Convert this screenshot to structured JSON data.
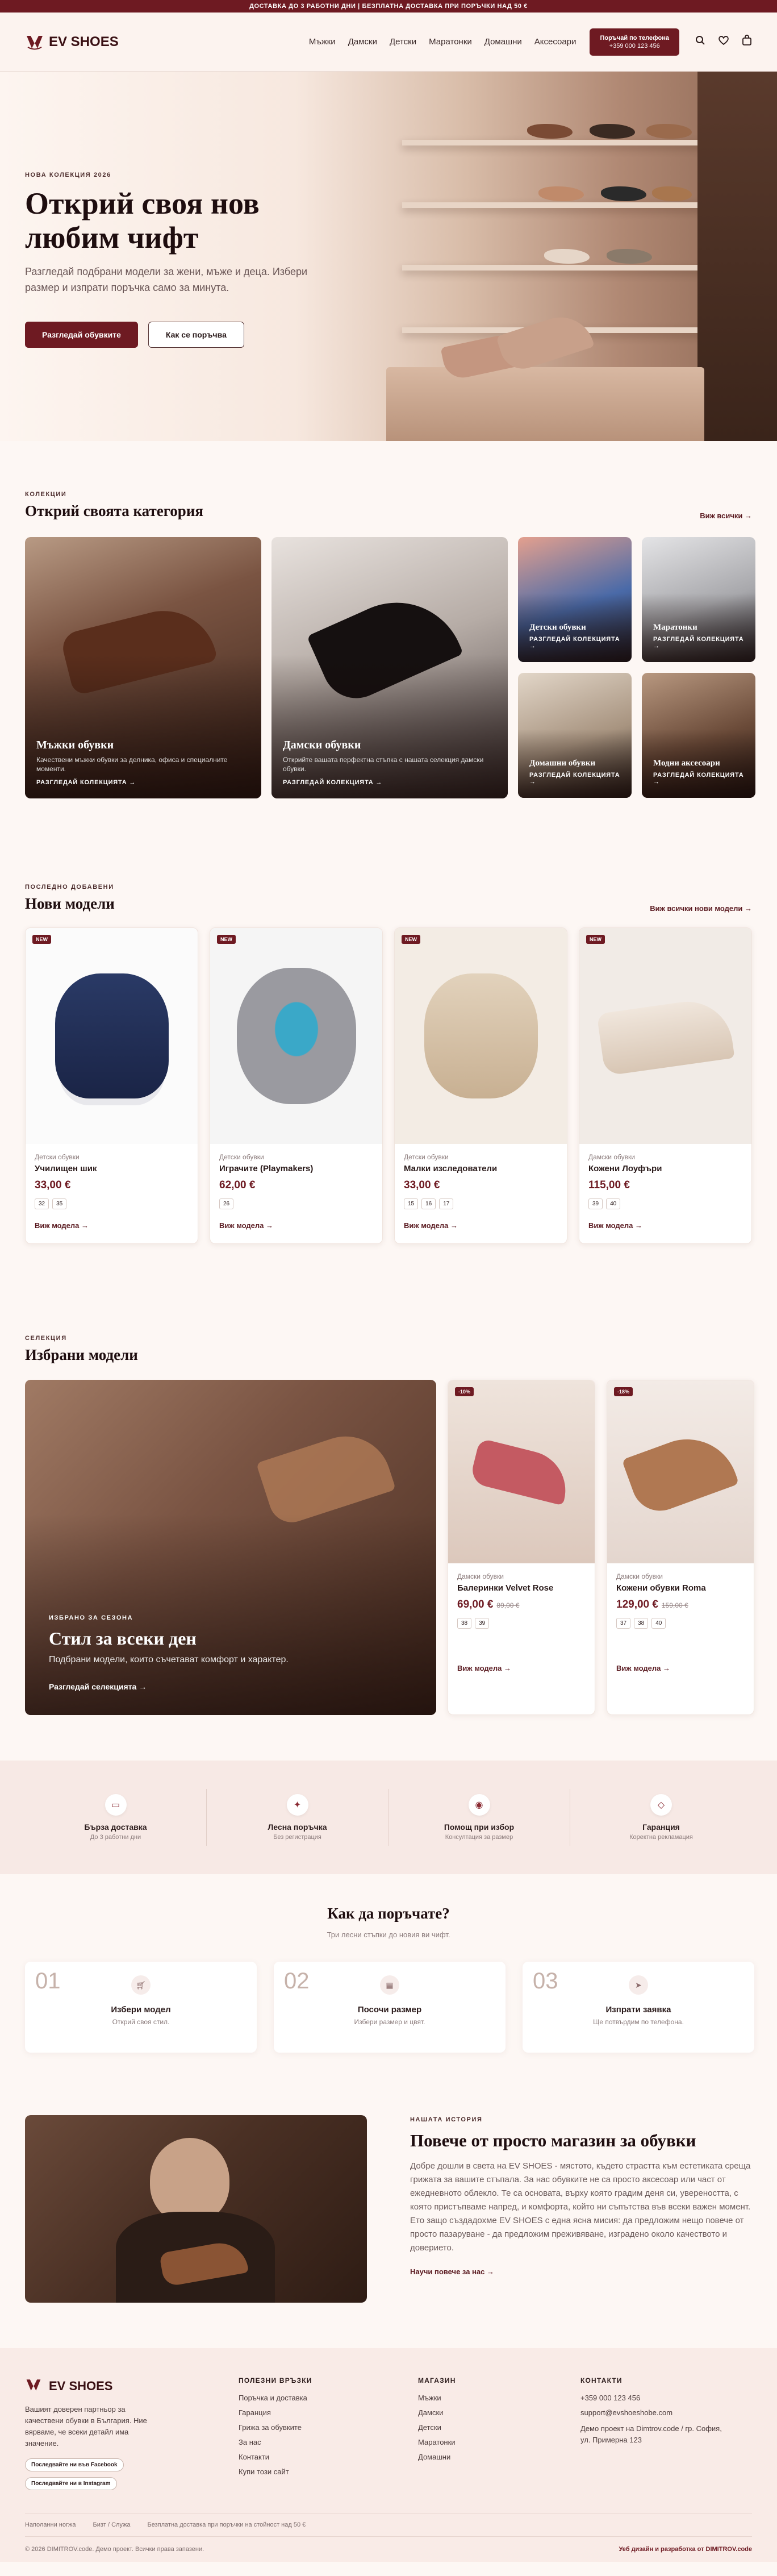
{
  "topbar": {
    "text": "ДОСТАВКА ДО 3 РАБОТНИ ДНИ | БЕЗПЛАТНА ДОСТАВКА ПРИ ПОРЪЧКИ НАД 50 €"
  },
  "header": {
    "logo": "EV SHOES",
    "nav": [
      "Мъжки",
      "Дамски",
      "Детски",
      "Маратонки",
      "Домашни",
      "Аксесоари"
    ],
    "phone_label": "Поръчай по телефона",
    "phone": "+359 000 123 456"
  },
  "hero": {
    "kicker": "НОВА КОЛЕКЦИЯ 2026",
    "title_line1": "Открий своя нов",
    "title_line2": "любим чифт",
    "text": "Разгледай подбрани модели за жени, мъже и деца. Избери размер и изпрати поръчка само за минута.",
    "primary_cta": "Разгледай обувките",
    "secondary_cta": "Как се поръчва"
  },
  "categories": {
    "kicker": "КОЛЕКЦИИ",
    "title": "Открий своята категория",
    "more": "Виж всички",
    "items": [
      {
        "title": "Мъжки обувки",
        "desc": "Качествени мъжки обувки за делника, офиса и специалните моменти.",
        "link": "РАЗГЛЕДАЙ КОЛЕКЦИЯТА"
      },
      {
        "title": "Дамски обувки",
        "desc": "Открийте вашата перфектна стъпка с нашата селекция дамски обувки.",
        "link": "РАЗГЛЕДАЙ КОЛЕКЦИЯТА"
      },
      {
        "title": "Детски обувки",
        "link": "РАЗГЛЕДАЙ КОЛЕКЦИЯТА"
      },
      {
        "title": "Маратонки",
        "link": "РАЗГЛЕДАЙ КОЛЕКЦИЯТА"
      },
      {
        "title": "Домашни обувки",
        "link": "РАЗГЛЕДАЙ КОЛЕКЦИЯТА"
      },
      {
        "title": "Модни аксесоари",
        "link": "РАЗГЛЕДАЙ КОЛЕКЦИЯТА"
      }
    ]
  },
  "new_models": {
    "kicker": "ПОСЛЕДНО ДОБАВЕНИ",
    "title": "Нови модели",
    "more": "Виж всички нови модели",
    "products": [
      {
        "badge": "NEW",
        "category": "Детски обувки",
        "name": "Училищен шик",
        "price": "33,00 €",
        "sizes": [
          "32",
          "35"
        ],
        "link": "Виж модела"
      },
      {
        "badge": "NEW",
        "category": "Детски обувки",
        "name": "Играчите (Playmakers)",
        "price": "62,00 €",
        "sizes": [
          "26"
        ],
        "link": "Виж модела"
      },
      {
        "badge": "NEW",
        "category": "Детски обувки",
        "name": "Малки изследователи",
        "price": "33,00 €",
        "sizes": [
          "15",
          "16",
          "17"
        ],
        "link": "Виж модела"
      },
      {
        "badge": "NEW",
        "category": "Дамски обувки",
        "name": "Кожени Лоуфъри",
        "price": "115,00 €",
        "sizes": [
          "39",
          "40"
        ],
        "link": "Виж модела"
      }
    ]
  },
  "featured": {
    "kicker": "СЕЛЕКЦИЯ",
    "title": "Избрани модели",
    "banner_kicker": "ИЗБРАНО ЗА СЕЗОНА",
    "banner_title": "Стил за всеки ден",
    "banner_text": "Подбрани модели, които съчетават комфорт и характер.",
    "banner_link": "Разгледай селекцията",
    "products": [
      {
        "badge": "-10%",
        "category": "Дамски обувки",
        "name": "Балеринки Velvet Rose",
        "price": "69,00 €",
        "old_price": "89,00 €",
        "sizes": [
          "38",
          "39"
        ],
        "link": "Виж модела"
      },
      {
        "badge": "-18%",
        "category": "Дамски обувки",
        "name": "Кожени обувки Roma",
        "price": "129,00 €",
        "old_price": "159,00 €",
        "sizes": [
          "37",
          "38",
          "40"
        ],
        "link": "Виж модела"
      }
    ]
  },
  "benefits": [
    {
      "icon": "truck-icon",
      "title": "Бърза доставка",
      "text": "До 3 работни дни"
    },
    {
      "icon": "sparkle-icon",
      "title": "Лесна поръчка",
      "text": "Без регистрация"
    },
    {
      "icon": "target-icon",
      "title": "Помощ при избор",
      "text": "Консултация за размер"
    },
    {
      "icon": "diamond-icon",
      "title": "Гаранция",
      "text": "Коректна рекламация"
    }
  ],
  "how_to": {
    "title": "Как да поръчате?",
    "subtitle": "Три лесни стъпки до новия ви чифт.",
    "steps": [
      {
        "num": "01",
        "title": "Избери модел",
        "text": "Открий своя стил."
      },
      {
        "num": "02",
        "title": "Посочи размер",
        "text": "Избери размер и цвят."
      },
      {
        "num": "03",
        "title": "Изпрати заявка",
        "text": "Ще потвърдим по телефона."
      }
    ]
  },
  "story": {
    "kicker": "НАШАТА ИСТОРИЯ",
    "title": "Повече от просто магазин за обувки",
    "text": "Добре дошли в света на EV SHOES - мястото, където страстта към естетиката среща грижата за вашите стъпала. За нас обувките не са просто аксесоар или част от ежедневното облекло. Те са основата, върху която градим деня си, увереността, с която пристъпваме напред, и комфорта, който ни съпътства във всеки важен момент. Ето защо създадохме EV SHOES с една ясна мисия: да предложим нещо повече от просто пазаруване - да предложим преживяване, изградено около качеството и доверието.",
    "link": "Научи повече за нас"
  },
  "footer": {
    "logo": "EV SHOES",
    "about": "Вашият доверен партньор за качествени обувки в България. Ние вярваме, че всеки детайл има значение.",
    "social": [
      "Последвайте ни във Facebook",
      "Последвайте ни в Instagram"
    ],
    "useful_title": "ПОЛЕЗНИ ВРЪЗКИ",
    "useful": [
      "Поръчка и доставка",
      "Гаранция",
      "Грижа за обувките",
      "За нас",
      "Контакти",
      "Купи този сайт"
    ],
    "shop_title": "МАГАЗИН",
    "shop": [
      "Мъжки",
      "Дамски",
      "Детски",
      "Маратонки",
      "Домашни"
    ],
    "contact_title": "КОНТАКТИ",
    "contact": [
      "+359 000 123 456",
      "support@evshoeshobe.com",
      "Демо проект на Dimtrov.code / гр. София, ул. Примерна 123"
    ],
    "bottom": [
      "Наполанни ногжа",
      "Бизт / Служа",
      "Безплатна доставка при поръчки на стойност над 50 €"
    ],
    "copyright": "© 2026 DIMITROV.code. Демо проект. Всички права запазени.",
    "credit": "Уеб дизайн и разработка от DIMITROV.code"
  },
  "colors": {
    "brand": "#6e1a22",
    "background": "#fdf7f4"
  }
}
